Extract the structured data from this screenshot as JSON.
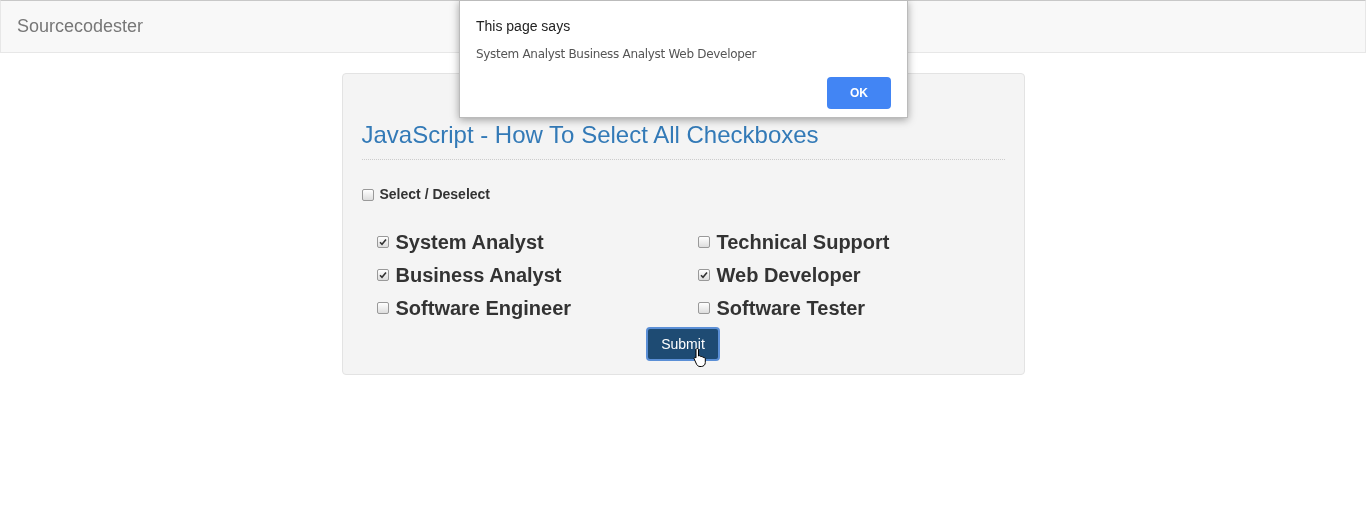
{
  "navbar": {
    "brand": "Sourcecodester"
  },
  "panel": {
    "title": "JavaScript - How To Select All Checkboxes",
    "select_all": {
      "label": "Select / Deselect",
      "checked": false
    },
    "options": [
      {
        "label": "System Analyst",
        "checked": true
      },
      {
        "label": "Technical Support",
        "checked": false
      },
      {
        "label": "Business Analyst",
        "checked": true
      },
      {
        "label": "Web Developer",
        "checked": true
      },
      {
        "label": "Software Engineer",
        "checked": false
      },
      {
        "label": "Software Tester",
        "checked": false
      }
    ],
    "submit": "Submit"
  },
  "dialog": {
    "title": "This page says",
    "message": "System Analyst Business Analyst Web Developer",
    "button": "OK"
  }
}
